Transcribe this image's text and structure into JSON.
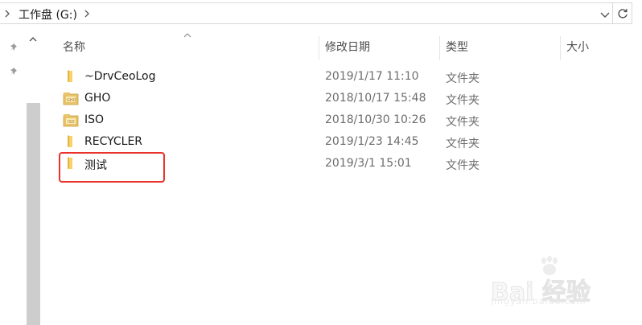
{
  "address_bar": {
    "path": "工作盘 (G:)"
  },
  "columns": {
    "name": "名称",
    "modified": "修改日期",
    "type": "类型",
    "size": "大小"
  },
  "files": [
    {
      "name": "~DrvCeoLog",
      "date": "2019/1/17 11:10",
      "type": "文件夹",
      "icon": "folder-icon"
    },
    {
      "name": "GHO",
      "date": "2018/10/17 15:48",
      "type": "文件夹",
      "icon": "locked-folder-icon"
    },
    {
      "name": "ISO",
      "date": "2018/10/30 10:26",
      "type": "文件夹",
      "icon": "locked-folder-icon"
    },
    {
      "name": "RECYCLER",
      "date": "2019/1/23 14:45",
      "type": "文件夹",
      "icon": "folder-icon"
    },
    {
      "name": "测试",
      "date": "2019/3/1 15:01",
      "type": "文件夹",
      "icon": "folder-icon"
    }
  ],
  "highlight_color": "#e8332c",
  "watermark": {
    "brand": "Bai 经验",
    "url": "jingyan.baidu.com"
  }
}
